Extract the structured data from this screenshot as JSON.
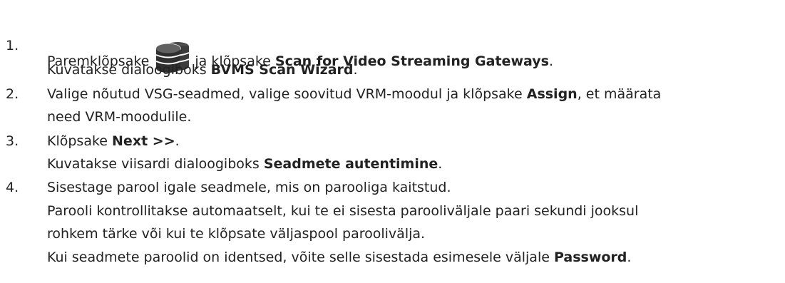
{
  "steps": [
    {
      "number": "1.",
      "lines": [
        {
          "before": "Paremklõpsake",
          "icon": "database-servers-icon",
          "after": "ja klõpsake ",
          "bold": "Scan for Video Streaming Gateways",
          "tail": "."
        },
        {
          "before": "Kuvatakse dialoogiboks ",
          "bold": "BVMS Scan Wizard",
          "tail": "."
        }
      ]
    },
    {
      "number": "2.",
      "lines": [
        {
          "before": "Valige nõutud VSG-seadmed, valige soovitud VRM-moodul ja klõpsake ",
          "bold": "Assign",
          "tail": ", et määrata"
        },
        {
          "before": "need VRM-moodulile."
        }
      ]
    },
    {
      "number": "3.",
      "lines": [
        {
          "before": "Klõpsake ",
          "bold": "Next >>",
          "tail": "."
        },
        {
          "before": "Kuvatakse viisardi dialoogiboks ",
          "bold": "Seadmete autentimine",
          "tail": "."
        }
      ]
    },
    {
      "number": "4.",
      "lines": [
        {
          "before": "Sisestage parool igale seadmele, mis on parooliga kaitstud."
        },
        {
          "before": "Parooli kontrollitakse automaatselt, kui te ei sisesta parooliväljale paari sekundi jooksul"
        },
        {
          "before": "rohkem tärke või kui te klõpsate väljaspool paroolivälja."
        },
        {
          "before": "Kui seadmete paroolid on identsed, võite selle sisestada esimesele väljale ",
          "bold": "Password",
          "tail": "."
        }
      ]
    }
  ]
}
